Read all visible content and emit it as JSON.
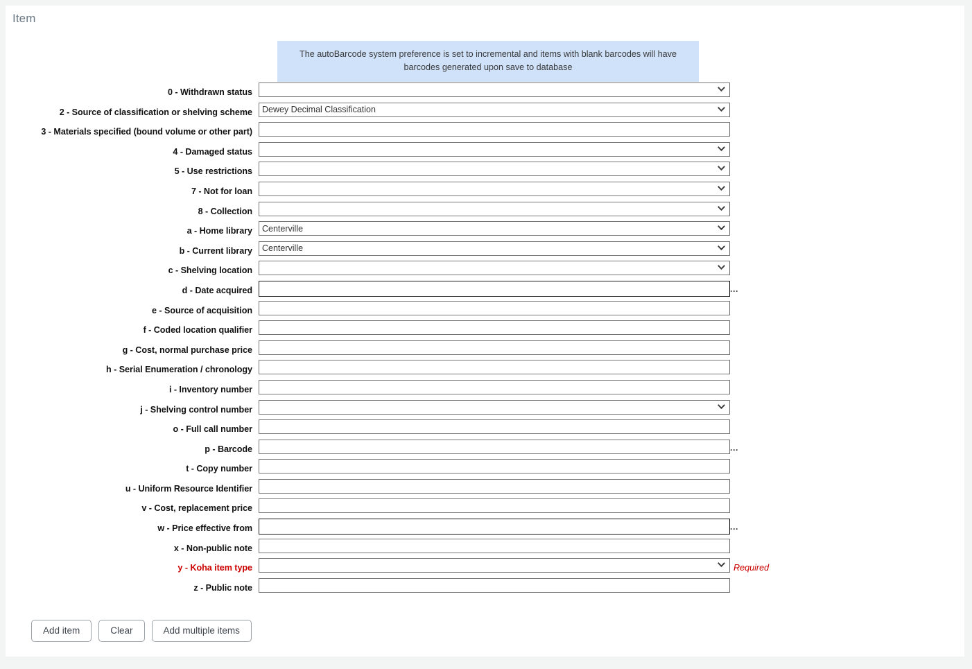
{
  "page": {
    "title": "Item"
  },
  "alert": {
    "message": "The autoBarcode system preference is set to incremental and items with blank barcodes will have barcodes generated upon save to database"
  },
  "markers": {
    "plugin_dots": "...",
    "required_text": "Required"
  },
  "fields": [
    {
      "label": "0 - Withdrawn status",
      "type": "select",
      "value": "",
      "required": false,
      "plugin": false,
      "thick": false
    },
    {
      "label": "2 - Source of classification or shelving scheme",
      "type": "select",
      "value": "Dewey Decimal Classification",
      "required": false,
      "plugin": false,
      "thick": false
    },
    {
      "label": "3 - Materials specified (bound volume or other part)",
      "type": "text",
      "value": "",
      "required": false,
      "plugin": false,
      "thick": false
    },
    {
      "label": "4 - Damaged status",
      "type": "select",
      "value": "",
      "required": false,
      "plugin": false,
      "thick": false
    },
    {
      "label": "5 - Use restrictions",
      "type": "select",
      "value": "",
      "required": false,
      "plugin": false,
      "thick": false
    },
    {
      "label": "7 - Not for loan",
      "type": "select",
      "value": "",
      "required": false,
      "plugin": false,
      "thick": false
    },
    {
      "label": "8 - Collection",
      "type": "select",
      "value": "",
      "required": false,
      "plugin": false,
      "thick": false
    },
    {
      "label": "a - Home library",
      "type": "select",
      "value": "Centerville",
      "required": false,
      "plugin": false,
      "thick": false
    },
    {
      "label": "b - Current library",
      "type": "select",
      "value": "Centerville",
      "required": false,
      "plugin": false,
      "thick": false
    },
    {
      "label": "c - Shelving location",
      "type": "select",
      "value": "",
      "required": false,
      "plugin": false,
      "thick": false
    },
    {
      "label": "d - Date acquired",
      "type": "text",
      "value": "",
      "required": false,
      "plugin": true,
      "thick": true
    },
    {
      "label": "e - Source of acquisition",
      "type": "text",
      "value": "",
      "required": false,
      "plugin": false,
      "thick": false
    },
    {
      "label": "f - Coded location qualifier",
      "type": "text",
      "value": "",
      "required": false,
      "plugin": false,
      "thick": false
    },
    {
      "label": "g - Cost, normal purchase price",
      "type": "text",
      "value": "",
      "required": false,
      "plugin": false,
      "thick": false
    },
    {
      "label": "h - Serial Enumeration / chronology",
      "type": "text",
      "value": "",
      "required": false,
      "plugin": false,
      "thick": false
    },
    {
      "label": "i - Inventory number",
      "type": "text",
      "value": "",
      "required": false,
      "plugin": false,
      "thick": false
    },
    {
      "label": "j - Shelving control number",
      "type": "select",
      "value": "",
      "required": false,
      "plugin": false,
      "thick": false
    },
    {
      "label": "o - Full call number",
      "type": "text",
      "value": "",
      "required": false,
      "plugin": false,
      "thick": false
    },
    {
      "label": "p - Barcode",
      "type": "text",
      "value": "",
      "required": false,
      "plugin": true,
      "thick": false
    },
    {
      "label": "t - Copy number",
      "type": "text",
      "value": "",
      "required": false,
      "plugin": false,
      "thick": false
    },
    {
      "label": "u - Uniform Resource Identifier",
      "type": "text",
      "value": "",
      "required": false,
      "plugin": false,
      "thick": false
    },
    {
      "label": "v - Cost, replacement price",
      "type": "text",
      "value": "",
      "required": false,
      "plugin": false,
      "thick": false
    },
    {
      "label": "w - Price effective from",
      "type": "text",
      "value": "",
      "required": false,
      "plugin": true,
      "thick": true
    },
    {
      "label": "x - Non-public note",
      "type": "text",
      "value": "",
      "required": false,
      "plugin": false,
      "thick": false
    },
    {
      "label": "y - Koha item type",
      "type": "select",
      "value": "",
      "required": true,
      "plugin": false,
      "thick": false
    },
    {
      "label": "z - Public note",
      "type": "text",
      "value": "",
      "required": false,
      "plugin": false,
      "thick": false
    }
  ],
  "actions": [
    {
      "label": "Add item",
      "name": "add-item-button"
    },
    {
      "label": "Clear",
      "name": "clear-button"
    },
    {
      "label": "Add multiple items",
      "name": "add-multiple-items-button"
    }
  ],
  "colors": {
    "card_background": "#ffffff",
    "page_background": "#f3f4f4",
    "alert_background": "#cfe2f9",
    "title_color": "#6c7a85",
    "required_color": "#cc0000"
  }
}
